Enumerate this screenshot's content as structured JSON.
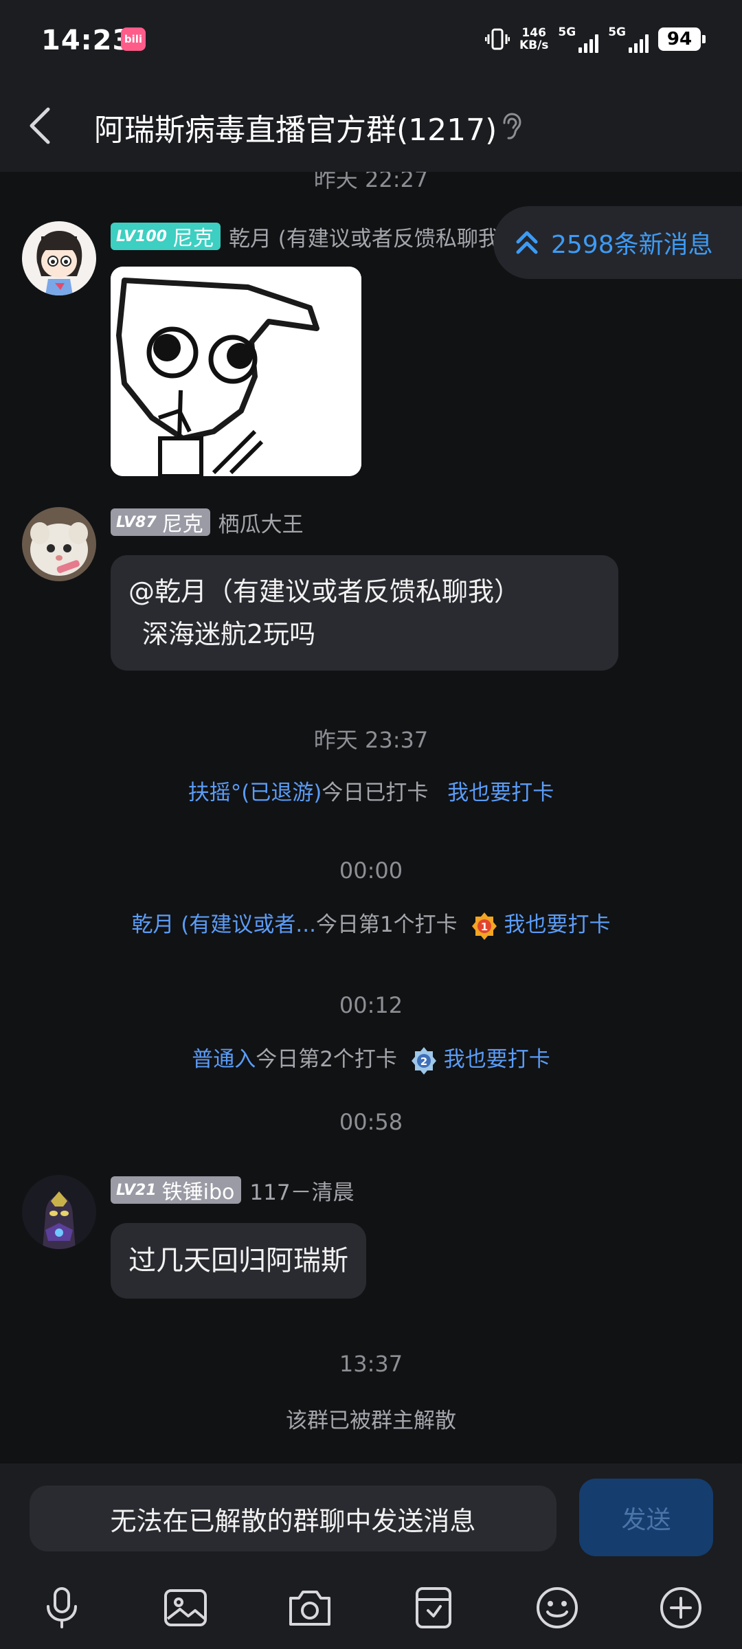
{
  "status_bar": {
    "time": "14:23",
    "app_badge": "bili",
    "speed_value": "146",
    "speed_unit": "KB/s",
    "net1": "5G",
    "net2": "5G",
    "battery": "94"
  },
  "header": {
    "title": "阿瑞斯病毒直播官方群(1217)"
  },
  "chat": {
    "top_time": "昨天 22:27",
    "new_messages": "2598条新消息",
    "messages": [
      {
        "level": "LV100",
        "tag": "尼克",
        "nickname": "乾月 (有建议或者反馈私聊我)"
      },
      {
        "level": "LV87",
        "tag": "尼克",
        "nickname": "栖瓜大王",
        "text_line1": "@乾月（有建议或者反馈私聊我）",
        "text_line2": "深海迷航2玩吗"
      },
      {
        "level": "LV21",
        "tag": "铁锤ibo",
        "nickname": "117－清晨",
        "text": "过几天回归阿瑞斯"
      }
    ],
    "timestamps": [
      "昨天 23:37",
      "00:00",
      "00:12",
      "00:58",
      "13:37"
    ],
    "checkins": [
      {
        "name": "扶摇°(已退游)",
        "text": "今日已打卡",
        "action": "我也要打卡"
      },
      {
        "name": "乾月 (有建议或者...",
        "text": "今日第1个打卡",
        "medal": "1",
        "action": "我也要打卡"
      },
      {
        "name": "普通入",
        "text": "今日第2个打卡",
        "medal": "2",
        "action": "我也要打卡"
      }
    ],
    "system_notice": "该群已被群主解散"
  },
  "input": {
    "placeholder": "无法在已解散的群聊中发送消息",
    "send_label": "发送"
  },
  "icons": [
    "microphone-icon",
    "image-icon",
    "camera-icon",
    "sticker-icon",
    "emoji-icon",
    "plus-icon"
  ],
  "colors": {
    "background": "#111214",
    "bar": "#1c1d21",
    "bubble": "#2a2b30",
    "link": "#5b9cf6",
    "new_msg": "#3d9bf5",
    "level_teal": "#3dcfc1",
    "send_button": "#153d6e"
  }
}
